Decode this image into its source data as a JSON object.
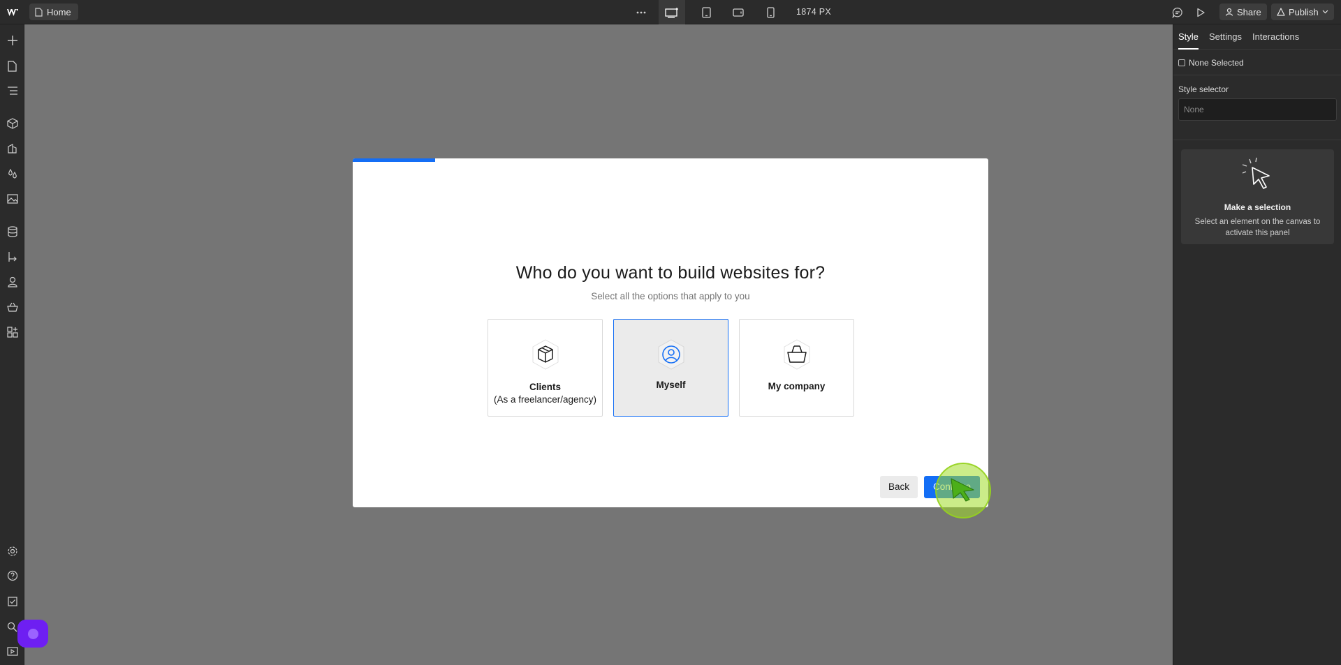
{
  "topbar": {
    "page_name": "Home",
    "breakpoint_width": "1874 PX",
    "share_label": "Share",
    "publish_label": "Publish"
  },
  "right_panel": {
    "tabs": [
      {
        "label": "Style"
      },
      {
        "label": "Settings"
      },
      {
        "label": "Interactions"
      }
    ],
    "none_selected": "None Selected",
    "style_selector_label": "Style selector",
    "style_selector_placeholder": "None",
    "make_selection_title": "Make a selection",
    "make_selection_desc": "Select an element on the canvas to activate this panel"
  },
  "modal": {
    "title": "Who do you want to build websites for?",
    "subtitle": "Select all the options that apply to you",
    "options": [
      {
        "label": "Clients",
        "sublabel": "(As a freelancer/agency)",
        "icon": "box-icon",
        "selected": false
      },
      {
        "label": "Myself",
        "sublabel": "",
        "icon": "person-icon",
        "selected": true
      },
      {
        "label": "My company",
        "sublabel": "",
        "icon": "basket-icon",
        "selected": false
      }
    ],
    "progress_fraction": 0.13,
    "back_label": "Back",
    "continue_label": "Continue"
  },
  "colors": {
    "accent": "#146ef5",
    "canvas": "#757575",
    "panel": "#2b2b2b",
    "help_bubble": "#6e1ff2",
    "click_indicator": "#a0dc28"
  }
}
